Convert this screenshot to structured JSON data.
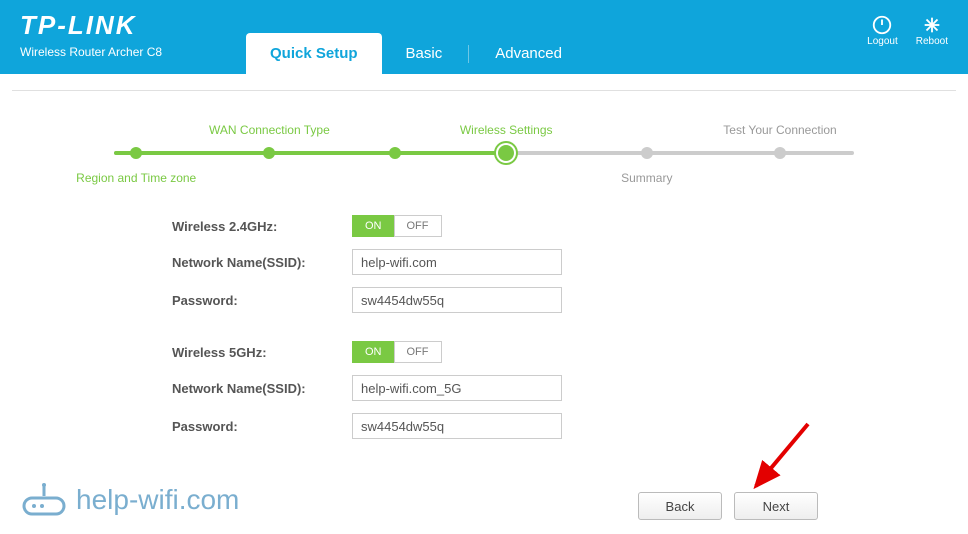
{
  "header": {
    "brand": "TP-LINK",
    "subtitle": "Wireless Router Archer C8",
    "tabs": {
      "quick": "Quick Setup",
      "basic": "Basic",
      "advanced": "Advanced"
    },
    "logout": "Logout",
    "reboot": "Reboot"
  },
  "progress": {
    "steps": {
      "region": "Region and Time zone",
      "wan": "WAN Connection Type",
      "wireless": "Wireless Settings",
      "summary": "Summary",
      "test": "Test Your Connection"
    }
  },
  "form": {
    "g24": {
      "title": "Wireless 2.4GHz:",
      "ssid_label": "Network Name(SSID):",
      "ssid_value": "help-wifi.com",
      "pwd_label": "Password:",
      "pwd_value": "sw4454dw55q"
    },
    "g5": {
      "title": "Wireless 5GHz:",
      "ssid_label": "Network Name(SSID):",
      "ssid_value": "help-wifi.com_5G",
      "pwd_label": "Password:",
      "pwd_value": "sw4454dw55q"
    },
    "on": "ON",
    "off": "OFF"
  },
  "buttons": {
    "back": "Back",
    "next": "Next"
  },
  "watermark": "help-wifi.com"
}
